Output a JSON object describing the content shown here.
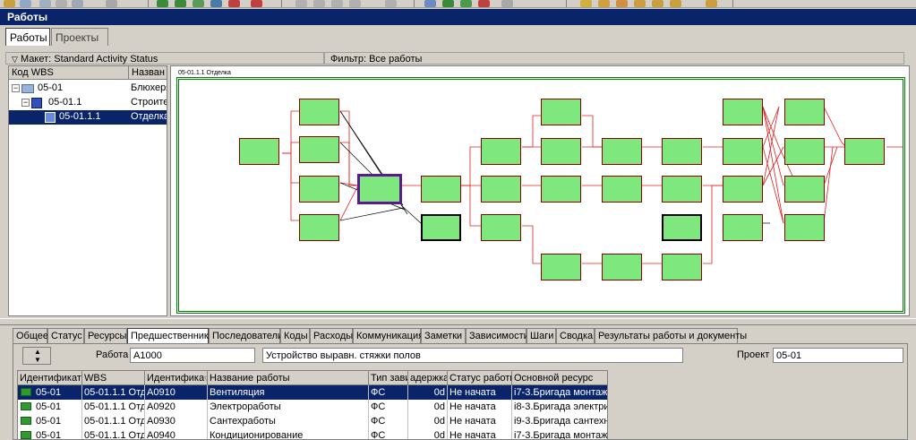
{
  "window": {
    "title": "Работы"
  },
  "top_tabs": [
    {
      "label": "Работы",
      "active": true
    },
    {
      "label": "Проекты",
      "active": false
    }
  ],
  "layout_bar": {
    "text": "Макет: Standard Activity Status"
  },
  "filter_bar": {
    "text": "Фильтр: Все работы"
  },
  "wbs": {
    "col_code": "Код WBS",
    "col_name": "Назван",
    "rows": [
      {
        "code": "05-01",
        "name": "Блюхеря"
      },
      {
        "code": "05-01.1",
        "name": "Строите"
      },
      {
        "code": "05-01.1.1",
        "name": "Отделка"
      }
    ]
  },
  "network": {
    "header": "05-01.1.1 Отделка",
    "node_colors": {
      "fill": "#7ee87e",
      "border": "#8b0000",
      "selected": "#5c1a8c",
      "link": "#e02020"
    }
  },
  "detail_tabs": [
    "Общее",
    "Статус",
    "Ресурсы",
    "Предшественники",
    "Последователи",
    "Коды",
    "Расходы",
    "Коммуникация",
    "Заметки",
    "Зависимости",
    "Шаги",
    "Сводка",
    "Результаты работы и документы"
  ],
  "detail": {
    "activity_label": "Работа",
    "activity_id": "A1000",
    "activity_name": "Устройство выравн. стяжки полов",
    "project_label": "Проект",
    "project_id": "05-01"
  },
  "grid": {
    "columns": [
      "Идентификато",
      "WBS",
      "Идентифика",
      "Название работы",
      "Тип зави",
      "адержка",
      "Статус работы",
      "Основной ресурс"
    ],
    "rows": [
      {
        "proj": "05-01",
        "wbs": "05-01.1.1 Отде",
        "id": "A0910",
        "name": "Вентиляция",
        "type": "ФС",
        "lag": "0d",
        "status": "Не начата",
        "resource": "i7-3.Бригада монтажні"
      },
      {
        "proj": "05-01",
        "wbs": "05-01.1.1 Отде",
        "id": "A0920",
        "name": "Электроработы",
        "type": "ФС",
        "lag": "0d",
        "status": "Не начата",
        "resource": "i8-3.Бригада электрик"
      },
      {
        "proj": "05-01",
        "wbs": "05-01.1.1 Отде",
        "id": "A0930",
        "name": "Сантехработы",
        "type": "ФС",
        "lag": "0d",
        "status": "Не начата",
        "resource": "i9-3.Бригада сантехни"
      },
      {
        "proj": "05-01",
        "wbs": "05-01.1.1 Отде",
        "id": "A0940",
        "name": "Кондиционирование",
        "type": "ФС",
        "lag": "0d",
        "status": "Не начата",
        "resource": "i7-3.Бригада монтажні"
      }
    ]
  }
}
